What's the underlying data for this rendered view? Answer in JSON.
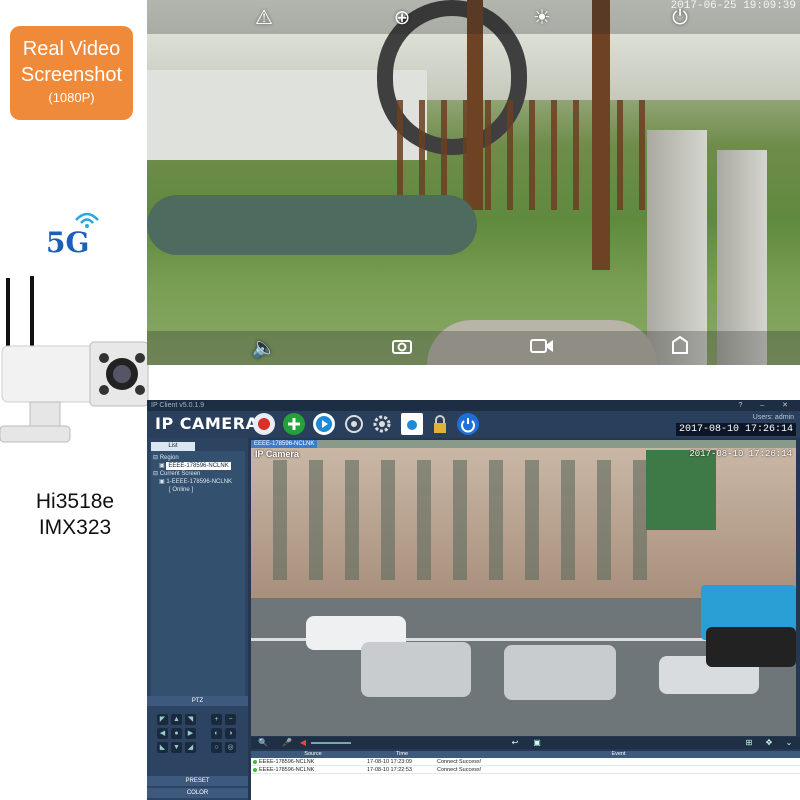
{
  "badge": {
    "line1": "Real Video",
    "line2": "Screenshot",
    "line3": "(1080P)",
    "color": "#ee8a3a"
  },
  "network_badge": {
    "text": "5G",
    "color": "#1b5fb8"
  },
  "chip_info": {
    "soc": "Hi3518e",
    "sensor": "IMX323"
  },
  "live_view": {
    "timestamp": "2017-06-25 19:09:39",
    "top_icons": [
      "warning-icon",
      "zoom-in-icon",
      "brightness-icon",
      "power-icon"
    ],
    "bottom_icons": [
      "speaker-icon",
      "camera-snapshot-icon",
      "video-record-icon",
      "share-icon"
    ]
  },
  "client": {
    "window_title": "IP Client v5.0.1.9",
    "brand": "IP CAMERA",
    "users_label": "Users: admin",
    "datetime": "2017-08-10 17:26:14",
    "toolbar_buttons": [
      "monitor",
      "add",
      "playback",
      "ptz",
      "settings",
      "media",
      "lock",
      "logout"
    ],
    "list_tab": "List",
    "tree": {
      "region": "Region",
      "region_device": "EEEE-178596-NCLNK",
      "current_screen": "Current Screen",
      "current_device": "1-EEEE-178596-NCLNK",
      "status": "[ Online ]"
    },
    "ptz_label": "PTZ",
    "preset_label": "PRESET",
    "color_label": "COLOR",
    "video_tab": "EEEE-178596-NCLNK",
    "video_label": "IP Camera",
    "video_timestamp": "2017-08-10 17:26:14",
    "log": {
      "headers": [
        "Source",
        "Time",
        "Event"
      ],
      "rows": [
        {
          "source": "EEEE-178596-NCLNK",
          "time": "17-08-10 17:23:09",
          "event": "Connect Success!"
        },
        {
          "source": "EEEE-178596-NCLNK",
          "time": "17-08-10 17:22:53",
          "event": "Connect Success!"
        }
      ]
    }
  }
}
